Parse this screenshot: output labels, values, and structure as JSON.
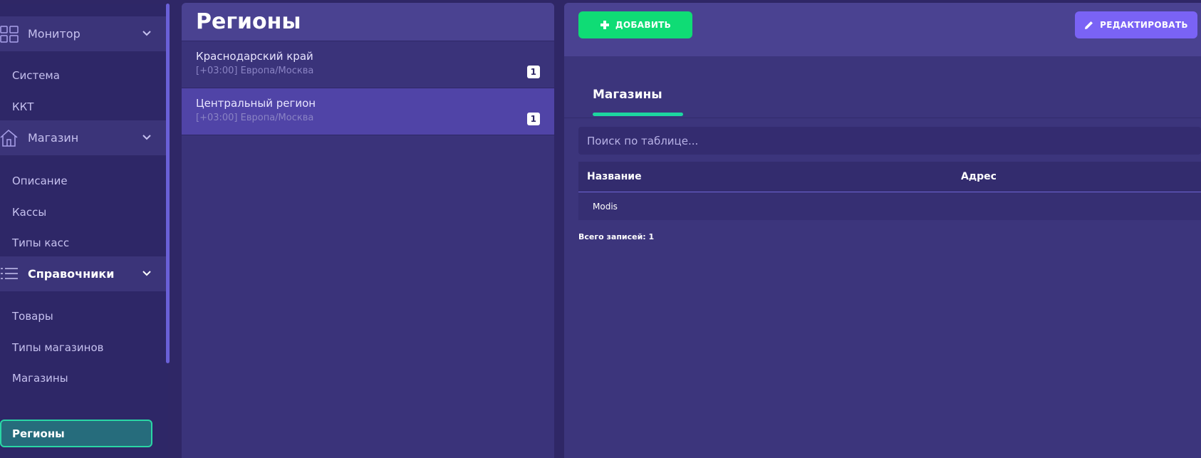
{
  "sidebar": {
    "sections": [
      {
        "label": "Монитор",
        "icon": "dashboard-grid-icon",
        "items": [
          "Система",
          "ККТ"
        ]
      },
      {
        "label": "Магазин",
        "icon": "house-icon",
        "items": [
          "Описание",
          "Кассы",
          "Типы касс"
        ]
      },
      {
        "label": "Справочники",
        "icon": "list-icon",
        "items": [
          "Товары",
          "Типы магазинов",
          "Магазины",
          "Регионы"
        ]
      }
    ],
    "selected_item": "Регионы"
  },
  "regions": {
    "title": "Регионы",
    "items": [
      {
        "name": "Краснодарский край",
        "timezone": "[+03:00] Европа/Москва",
        "count": "1"
      },
      {
        "name": "Центральный регион",
        "timezone": "[+03:00] Европа/Москва",
        "count": "1"
      }
    ]
  },
  "toolbar": {
    "add_label": "ДОБАВИТЬ",
    "edit_label": "РЕДАКТИРОВАТЬ"
  },
  "detail": {
    "tab_label": "Магазины",
    "search_placeholder": "Поиск по таблице...",
    "columns": [
      "Название",
      "Адрес"
    ],
    "rows": [
      {
        "name": "Modis",
        "address": ""
      }
    ],
    "total_label": "Всего записей: 1"
  },
  "colors": {
    "background": "#2f2766",
    "accent_green": "#0fdc75",
    "accent_purple": "#7a63f5",
    "selected_border": "#2ad6a5",
    "selected_region": "#5044a7"
  }
}
